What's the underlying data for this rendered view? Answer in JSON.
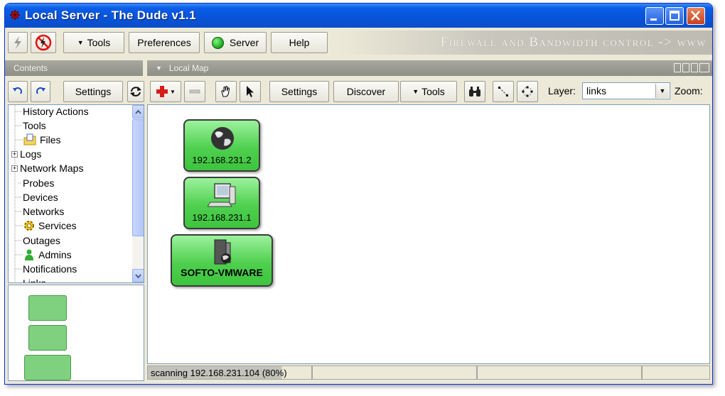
{
  "window": {
    "title": "Local Server - The Dude v1.1"
  },
  "toolbar": {
    "tools_label": "Tools",
    "preferences_label": "Preferences",
    "server_label": "Server",
    "help_label": "Help",
    "tagline": "Firewall and Bandwidth control -> www"
  },
  "contents_panel": {
    "header": "Contents",
    "settings_label": "Settings",
    "tree": [
      {
        "label": "History Actions"
      },
      {
        "label": "Tools"
      },
      {
        "label": "Files"
      },
      {
        "label": "Logs"
      },
      {
        "label": "Network Maps"
      },
      {
        "label": "Probes"
      },
      {
        "label": "Devices"
      },
      {
        "label": "Networks"
      },
      {
        "label": "Services"
      },
      {
        "label": "Outages"
      },
      {
        "label": "Admins"
      },
      {
        "label": "Notifications"
      },
      {
        "label": "Links"
      }
    ]
  },
  "map_panel": {
    "header": "Local Map",
    "settings_label": "Settings",
    "discover_label": "Discover",
    "tools_label": "Tools",
    "layer_label": "Layer:",
    "layer_value": "links",
    "zoom_label": "Zoom:"
  },
  "devices": [
    {
      "label": "192.168.231.2",
      "icon": "globe-icon"
    },
    {
      "label": "192.168.231.1",
      "icon": "computer-icon"
    },
    {
      "label": "SOFTO-VMWARE",
      "icon": "server-icon"
    }
  ],
  "status": {
    "text": "scanning 192.168.231.104 (80%)"
  },
  "colors": {
    "node_green": "#4fd04f",
    "title_blue": "#0853d8",
    "server_status": "#22b422"
  }
}
